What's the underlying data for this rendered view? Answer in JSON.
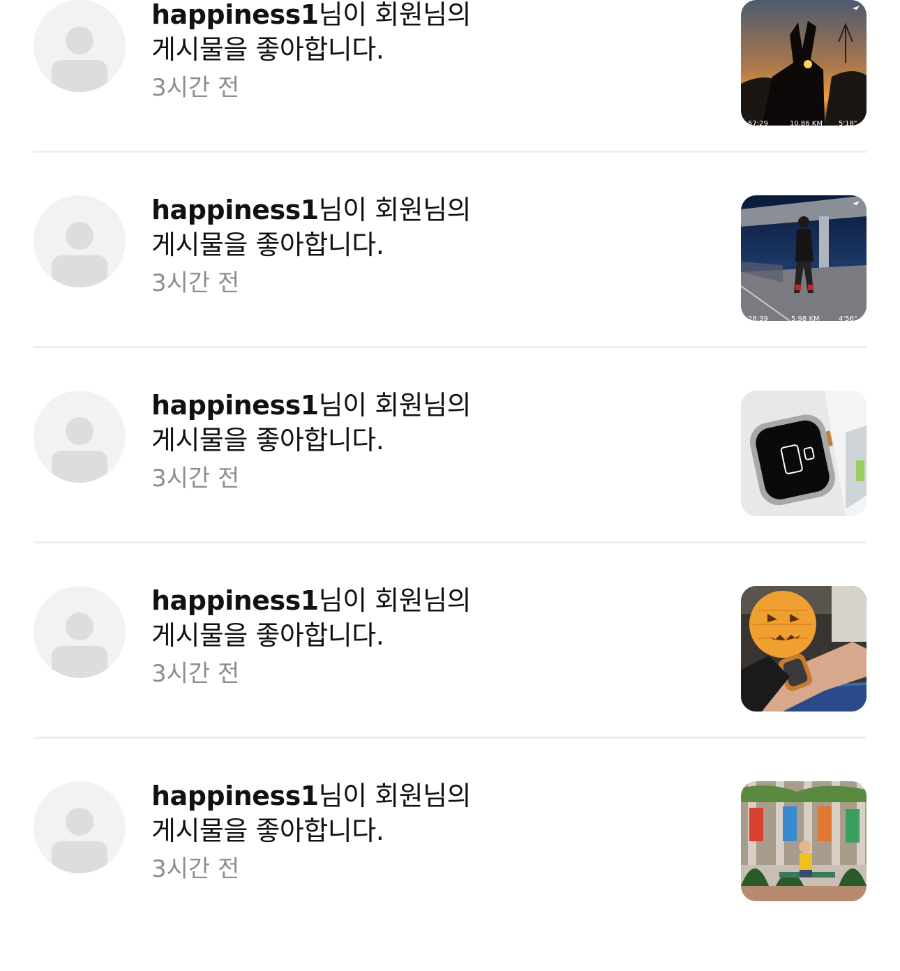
{
  "notifications": [
    {
      "user": "happiness1",
      "line1_suffix": "님이 회원님의",
      "line2": "게시물을 좋아합니다.",
      "time": "3시간 전",
      "thumb": "sunset-hand-photo",
      "stats": [
        "57:29",
        "10.86 KM",
        "5'18\""
      ]
    },
    {
      "user": "happiness1",
      "line1_suffix": "님이 회원님의",
      "line2": "게시물을 좋아합니다.",
      "time": "3시간 전",
      "thumb": "night-runner-photo",
      "stats": [
        "28:39",
        "5.98 KM",
        "4'56\""
      ]
    },
    {
      "user": "happiness1",
      "line1_suffix": "님이 회원님의",
      "line2": "게시물을 좋아합니다.",
      "time": "3시간 전",
      "thumb": "apple-watch-photo",
      "watch_text": "iPhone을 Apple Watch"
    },
    {
      "user": "happiness1",
      "line1_suffix": "님이 회원님의",
      "line2": "게시물을 좋아합니다.",
      "time": "3시간 전",
      "thumb": "halloween-lantern-photo"
    },
    {
      "user": "happiness1",
      "line1_suffix": "님이 회원님의",
      "line2": "게시물을 좋아합니다.",
      "time": "3시간 전",
      "thumb": "park-bench-photo"
    }
  ]
}
